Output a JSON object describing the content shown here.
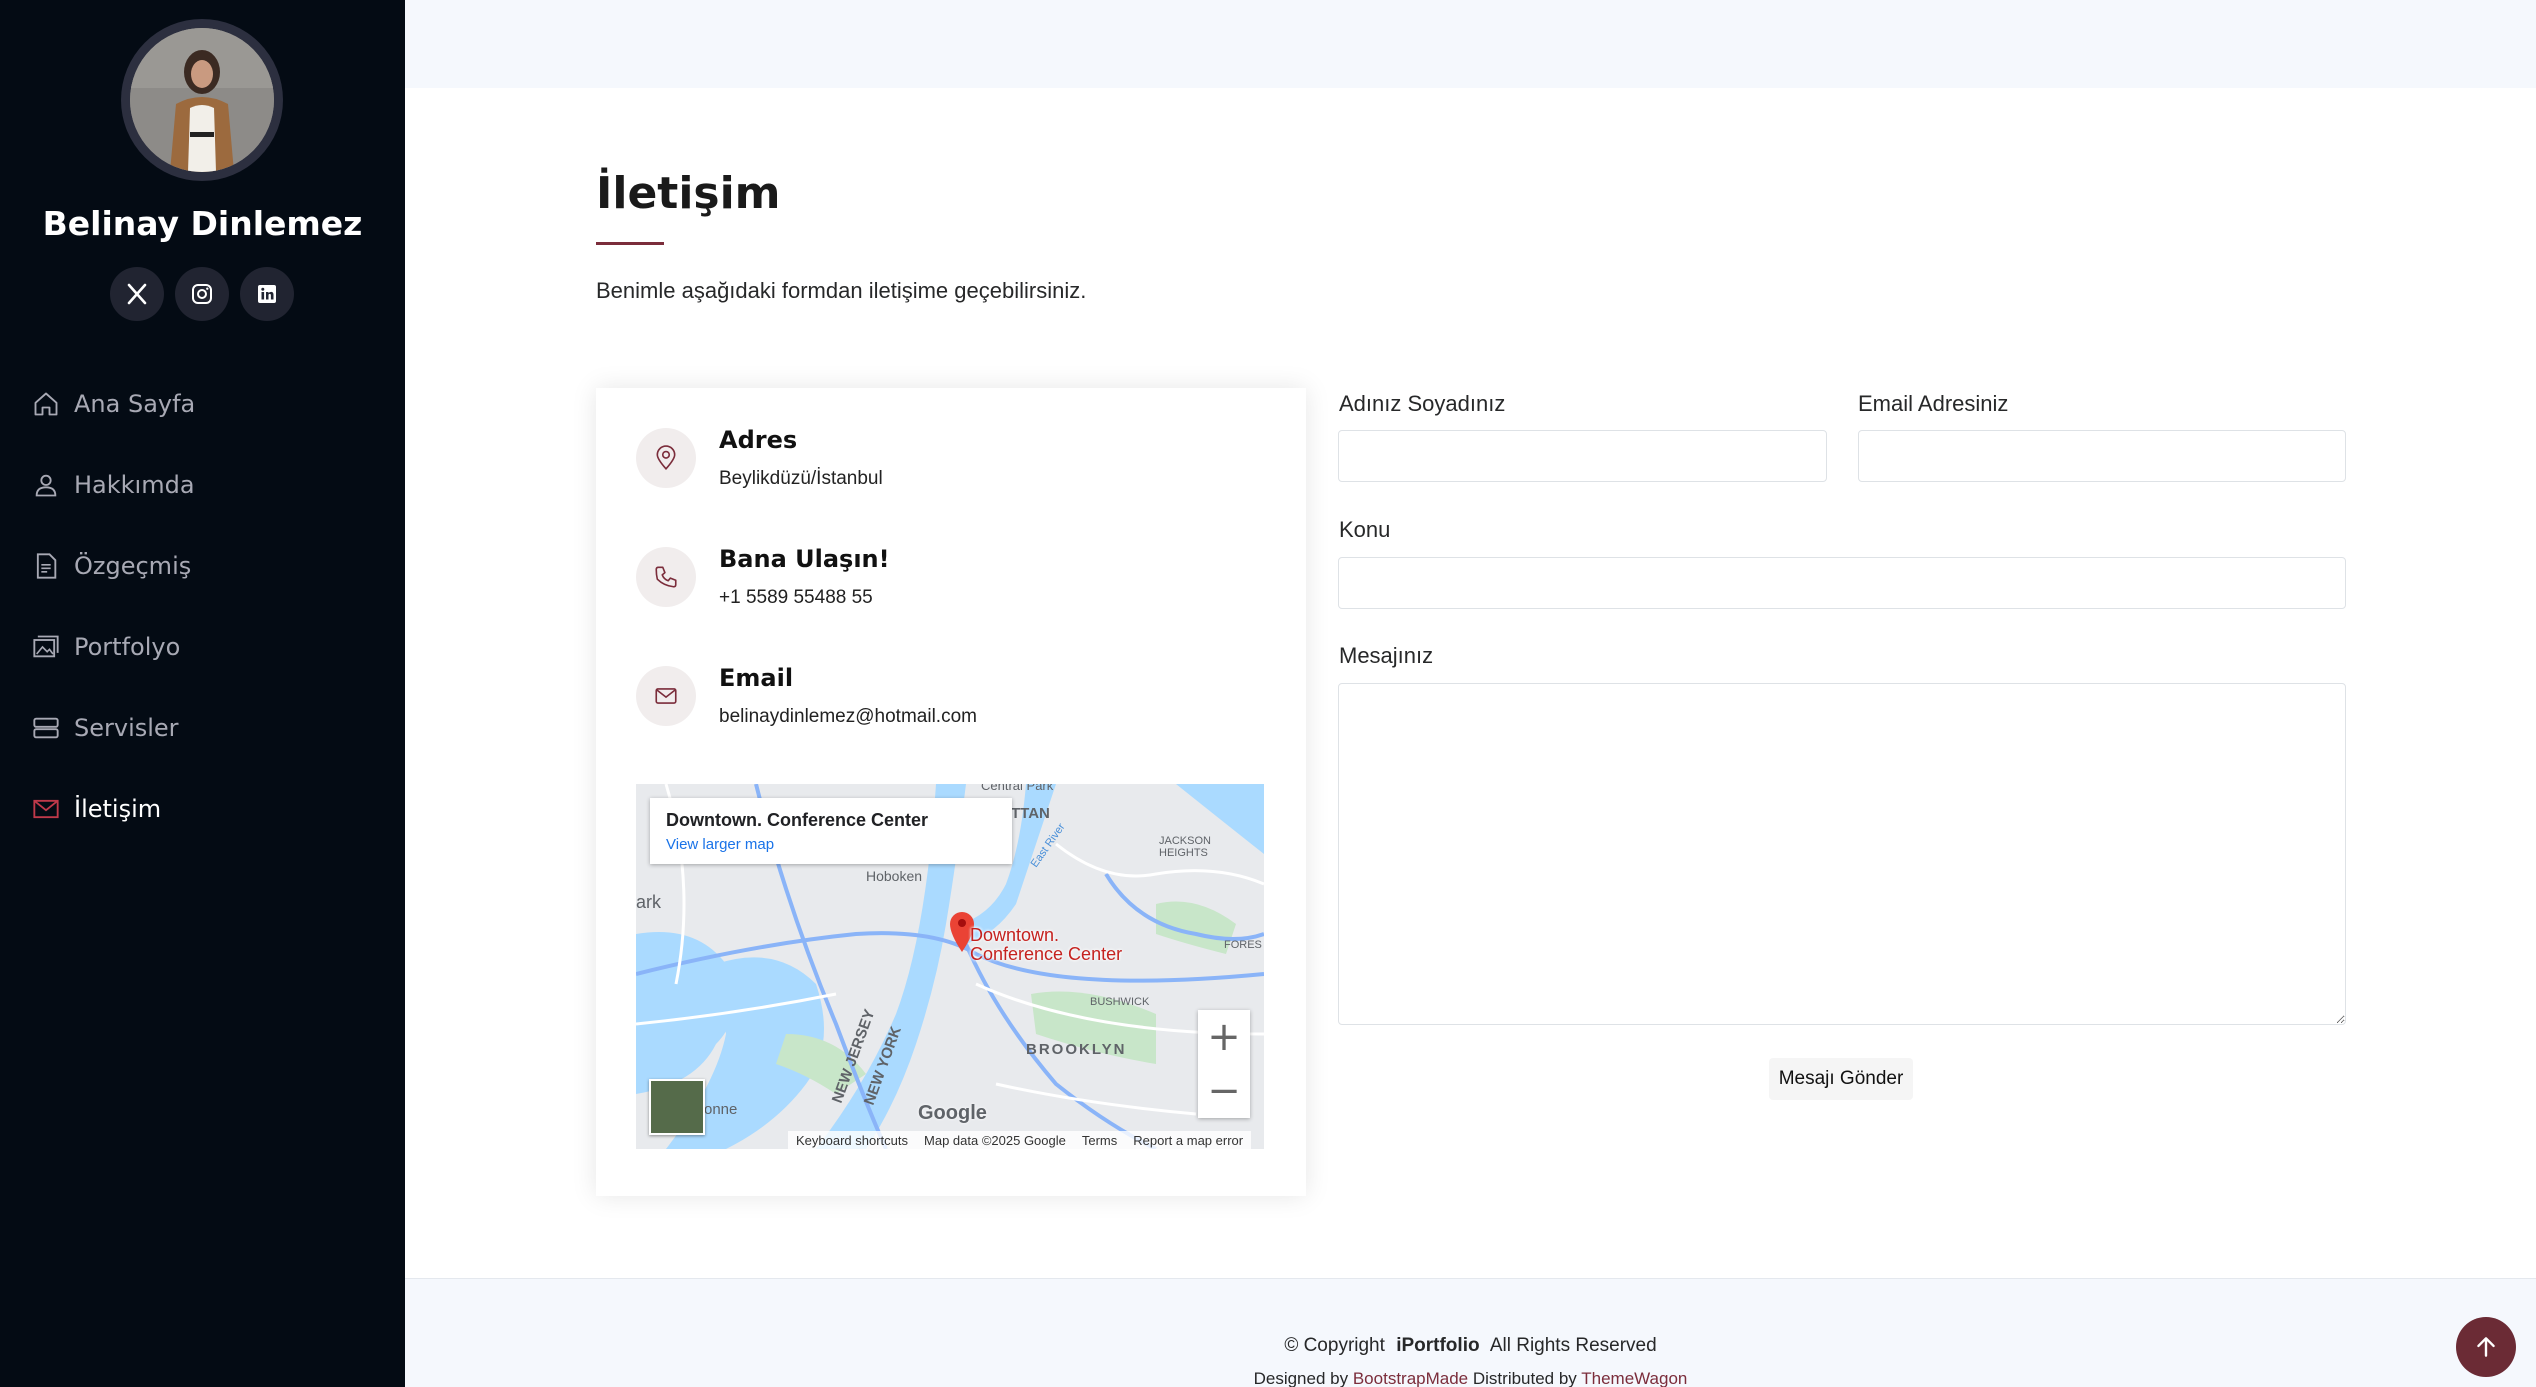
{
  "profile": {
    "name": "Belinay Dinlemez"
  },
  "socials": [
    {
      "icon": "x-twitter-icon"
    },
    {
      "icon": "instagram-icon"
    },
    {
      "icon": "linkedin-icon"
    }
  ],
  "nav": {
    "items": [
      {
        "label": "Ana Sayfa",
        "icon": "house-icon"
      },
      {
        "label": "Hakkımda",
        "icon": "person-icon"
      },
      {
        "label": "Özgeçmiş",
        "icon": "file-text-icon"
      },
      {
        "label": "Portfolyo",
        "icon": "images-icon"
      },
      {
        "label": "Servisler",
        "icon": "server-icon"
      },
      {
        "label": "İletişim",
        "icon": "envelope-icon",
        "active": true
      }
    ]
  },
  "section": {
    "title": "İletişim",
    "description": "Benimle aşağıdaki formdan iletişime geçebilirsiniz."
  },
  "info": {
    "address": {
      "title": "Adres",
      "value": "Beylikdüzü/İstanbul"
    },
    "phone": {
      "title": "Bana Ulaşın!",
      "value": "+1 5589 55488 55"
    },
    "email": {
      "title": "Email",
      "value": "belinaydinlemez@hotmail.com"
    }
  },
  "map": {
    "popup_place": "Downtown. Conference Center",
    "popup_link": "View larger map",
    "pin_label_line1": "Downtown.",
    "pin_label_line2": "Conference Center",
    "zoom_in": "+",
    "zoom_out": "−",
    "logo": "Google",
    "footer": {
      "shortcuts": "Keyboard shortcuts",
      "data": "Map data ©2025 Google",
      "terms": "Terms",
      "report": "Report a map error"
    },
    "labels": [
      "Hoboken",
      "JACKSON",
      "HEIGHTS",
      "BROOKLYN",
      "BUSHWICK",
      "NEW JERSEY",
      "NEW YORK",
      "FORES",
      "Central Park",
      "TTAN",
      "East River",
      "ark",
      "onne"
    ]
  },
  "form": {
    "name_label": "Adınız Soyadınız",
    "email_label": "Email Adresiniz",
    "subject_label": "Konu",
    "message_label": "Mesajınız",
    "name_value": "",
    "email_value": "",
    "subject_value": "",
    "message_value": "",
    "submit_label": "Mesajı Gönder"
  },
  "footer": {
    "copyright_prefix": "© Copyright",
    "brand": "iPortfolio",
    "rights": "All Rights Reserved",
    "designed_by": "Designed by",
    "designer": "BootstrapMade",
    "distributed_by": "Distributed by",
    "distributor": "ThemeWagon"
  },
  "colors": {
    "sidebar_bg": "#040b14",
    "accent": "#7b2d3b",
    "back_to_top": "#6b2b35"
  }
}
